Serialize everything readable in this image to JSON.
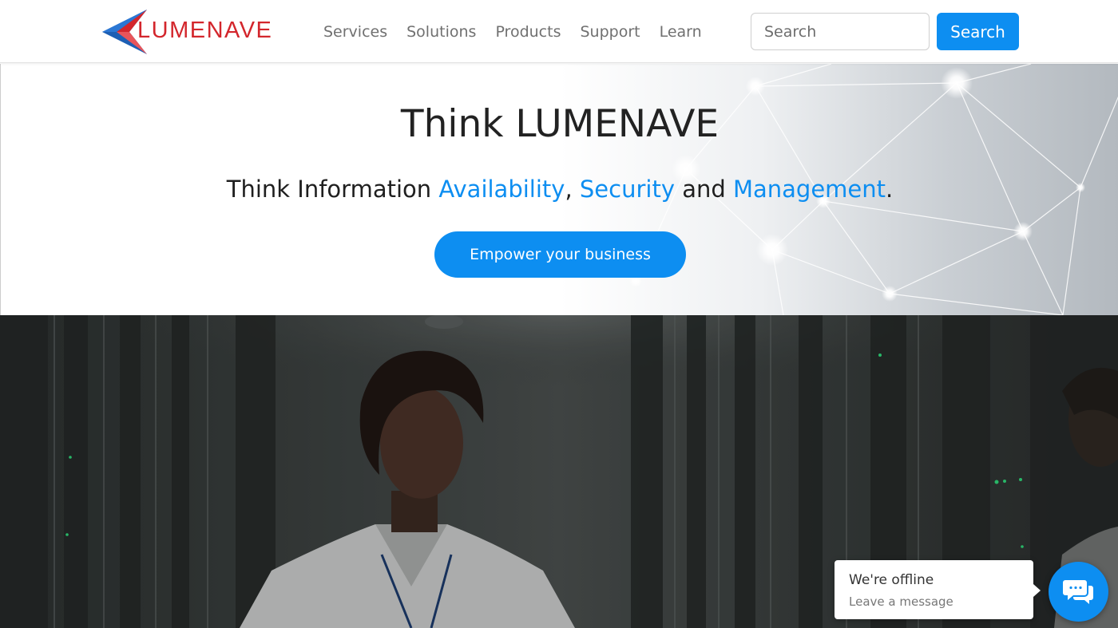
{
  "header": {
    "logo_text": "LUMENAVE",
    "nav": [
      {
        "label": "Services"
      },
      {
        "label": "Solutions"
      },
      {
        "label": "Products"
      },
      {
        "label": "Support"
      },
      {
        "label": "Learn"
      }
    ],
    "search": {
      "placeholder": "Search",
      "button_label": "Search"
    }
  },
  "hero": {
    "title": "Think LUMENAVE",
    "subtitle": {
      "prefix": "Think Information ",
      "highlight1": "Availability",
      "sep1": ", ",
      "highlight2": "Security",
      "sep2": " and ",
      "highlight3": "Management",
      "suffix": "."
    },
    "cta_label": "Empower your business"
  },
  "chat": {
    "status": "We're offline",
    "prompt": "Leave a message"
  },
  "colors": {
    "accent": "#0d8ef1",
    "logo_red": "#d3262c",
    "logo_blue": "#1d5fb4"
  },
  "icons": {
    "logo_mark": "lumenave-arrow-logo",
    "chat": "chat-bubbles-icon"
  }
}
